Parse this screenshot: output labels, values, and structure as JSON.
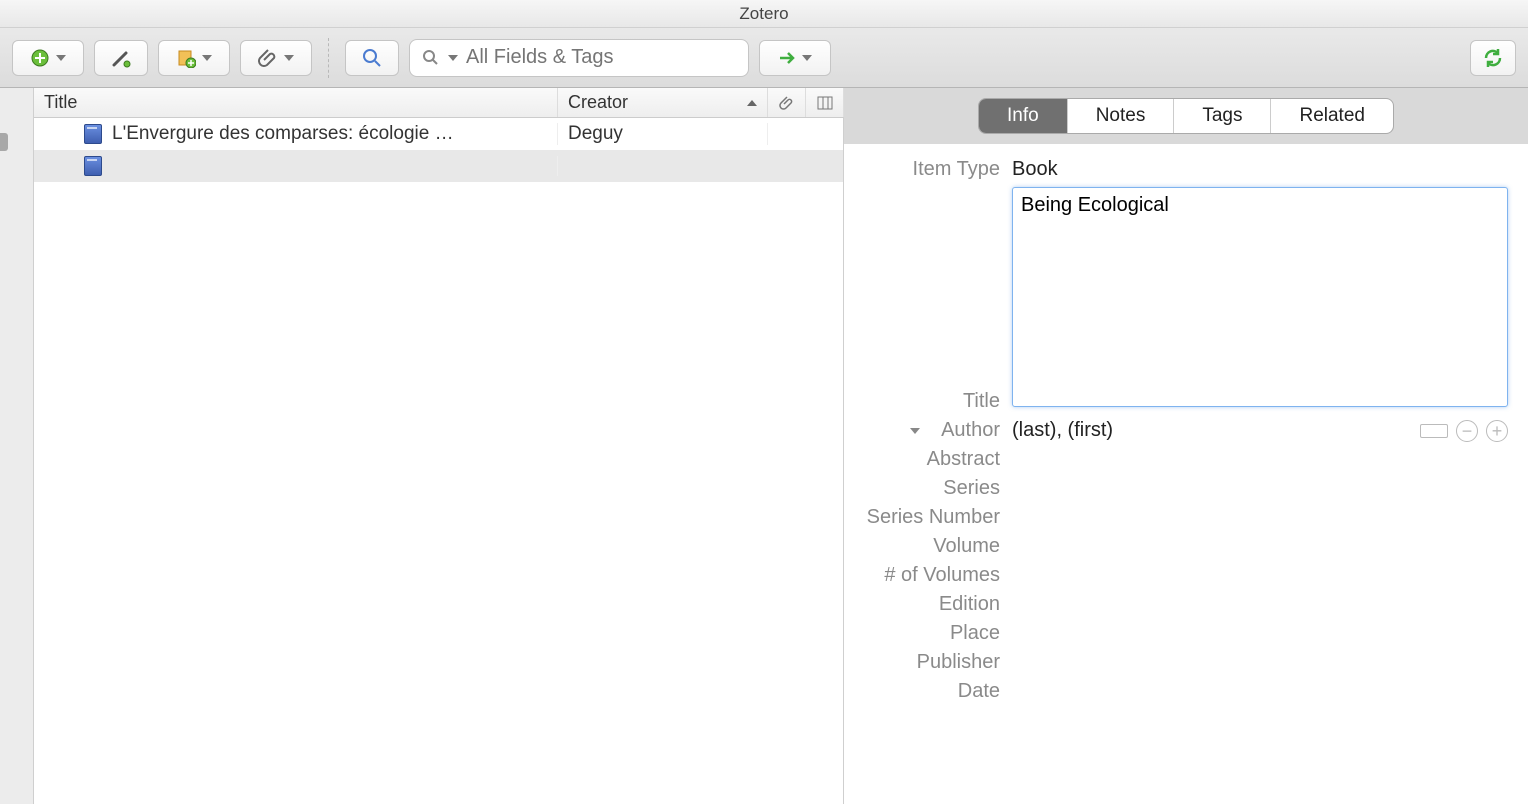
{
  "app": {
    "title": "Zotero"
  },
  "toolbar": {
    "search": {
      "placeholder": "All Fields & Tags",
      "value": ""
    }
  },
  "columns": {
    "title": "Title",
    "creator": "Creator"
  },
  "items": [
    {
      "title": "L'Envergure des comparses: écologie …",
      "creator": "Deguy",
      "selected": false
    },
    {
      "title": "",
      "creator": "",
      "selected": true
    }
  ],
  "pane": {
    "tabs": {
      "info": "Info",
      "notes": "Notes",
      "tags": "Tags",
      "related": "Related"
    },
    "active_tab": "info",
    "fields": {
      "item_type_label": "Item Type",
      "item_type_value": "Book",
      "title_label": "Title",
      "title_value": "Being Ecological",
      "author_label": "Author",
      "author_value": "(last), (first)",
      "abstract_label": "Abstract",
      "series_label": "Series",
      "series_number_label": "Series Number",
      "volume_label": "Volume",
      "num_volumes_label": "# of Volumes",
      "edition_label": "Edition",
      "place_label": "Place",
      "publisher_label": "Publisher",
      "date_label": "Date"
    }
  }
}
